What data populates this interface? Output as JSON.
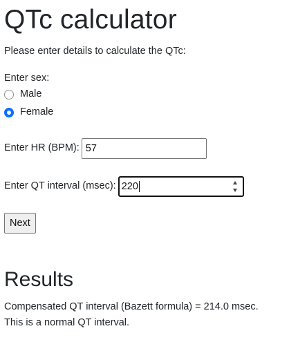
{
  "page": {
    "title": "QTc calculator",
    "intro": "Please enter details to calculate the QTc:"
  },
  "form": {
    "sex": {
      "label": "Enter sex:",
      "options": [
        {
          "label": "Male",
          "checked": false
        },
        {
          "label": "Female",
          "checked": true
        }
      ]
    },
    "hr": {
      "label": "Enter HR (BPM):",
      "value": "57"
    },
    "qt": {
      "label": "Enter QT interval (msec):",
      "value": "220"
    },
    "next_label": "Next"
  },
  "results": {
    "title": "Results",
    "line1": "Compensated QT interval (Bazett formula) = 214.0 msec.",
    "line2": "This is a normal QT interval."
  },
  "colors": {
    "accent": "#0d6efd",
    "text": "#212529"
  }
}
